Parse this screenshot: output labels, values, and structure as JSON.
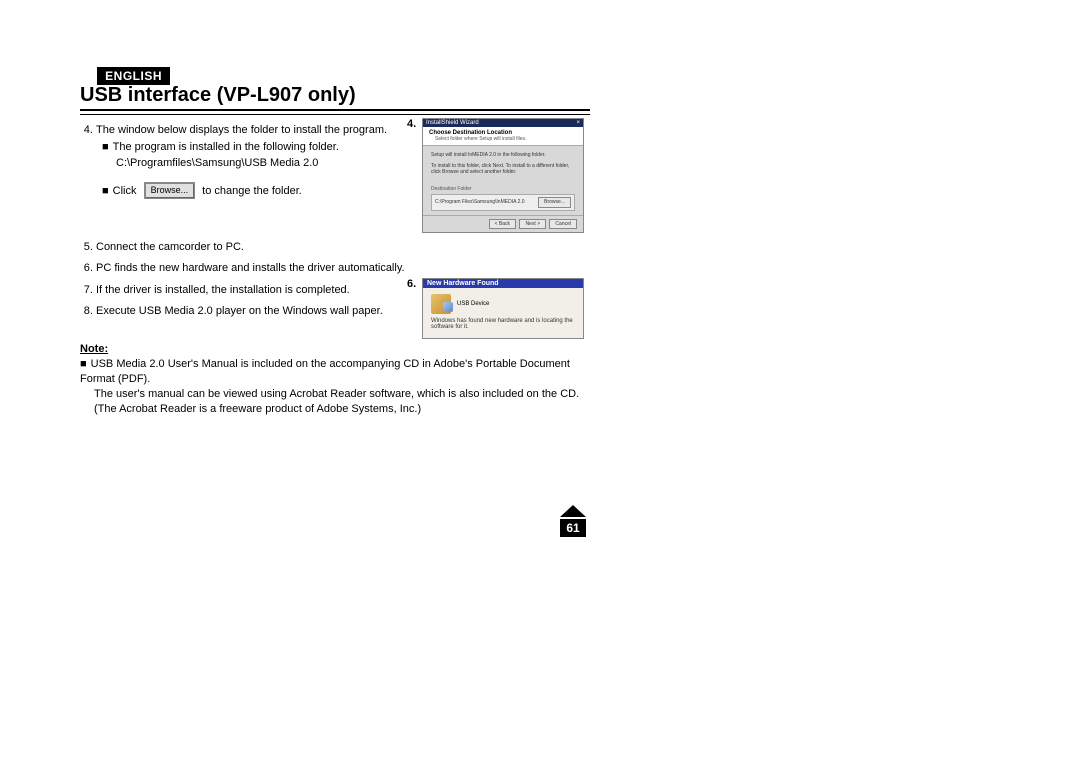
{
  "language_label": "ENGLISH",
  "title": "USB interface (VP-L907 only)",
  "figure4_label": "4.",
  "figure6_label": "6.",
  "steps": {
    "s4_text": "The window below displays the folder to install the program.",
    "s4_sub1": "The program is installed in the following folder.",
    "s4_path": "C:\\Programfiles\\Samsung\\USB Media 2.0",
    "s4_click_pre": "Click",
    "s4_click_post": "to change the folder.",
    "browse_label": "Browse...",
    "s5_text": "Connect the camcorder to PC.",
    "s6_text": "PC finds the new hardware and installs the driver automatically.",
    "s7_text": "If the driver is installed, the installation is completed.",
    "s8_text": "Execute USB Media 2.0 player on the Windows wall paper."
  },
  "wizard": {
    "titlebar": "InstallShield Wizard",
    "close": "×",
    "heading": "Choose Destination Location",
    "subheading": "Select folder where Setup will install files.",
    "body1": "Setup will install InMEDIA 2.0 in the following folder.",
    "body2": "To install to this folder, click Next. To install to a different folder, click Browse and select another folder.",
    "group": "Destination Folder",
    "path": "C:\\Program Files\\Samsung\\InMEDIA 2.0",
    "browse": "Browse...",
    "back": "< Back",
    "next": "Next >",
    "cancel": "Cancel"
  },
  "nhf": {
    "titlebar": "New Hardware Found",
    "device": "USB Device",
    "msg": "Windows has found new hardware and is locating the software for it."
  },
  "note": {
    "heading": "Note:",
    "line1": "USB Media 2.0 User's Manual is included on the accompanying CD in Adobe's Portable Document Format (PDF).",
    "line2": "The user's manual can be viewed using Acrobat Reader software, which is also included on the CD.",
    "line3": "(The Acrobat Reader is a freeware product of Adobe Systems, Inc.)"
  },
  "page_number": "61"
}
